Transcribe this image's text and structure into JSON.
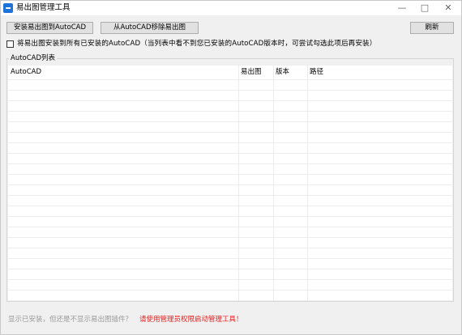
{
  "window": {
    "title": "易出图管理工具",
    "controls": {
      "minimize": "—",
      "maximize": "□",
      "close": "✕"
    }
  },
  "toolbar": {
    "install_label": "安装易出图到AutoCAD",
    "remove_label": "从AutoCAD移除易出图",
    "refresh_label": "刷新"
  },
  "option": {
    "checked": false,
    "label": "将易出图安装到所有已安装的AutoCAD（当列表中看不到您已安装的AutoCAD版本时，可尝试勾选此项后再安装）"
  },
  "autocad_list": {
    "title": "AutoCAD列表",
    "columns": [
      "AutoCAD",
      "易出图",
      "版本",
      "路径"
    ],
    "rows": []
  },
  "footer": {
    "note": "显示已安装，但还是不显示易出图插件？",
    "warning": "请使用管理员权限启动管理工具！"
  },
  "icons": {
    "app": "app-window-icon"
  },
  "colors": {
    "warning": "#e81e1e",
    "note": "#9a9a9a",
    "app_icon": "#1e73d8"
  }
}
